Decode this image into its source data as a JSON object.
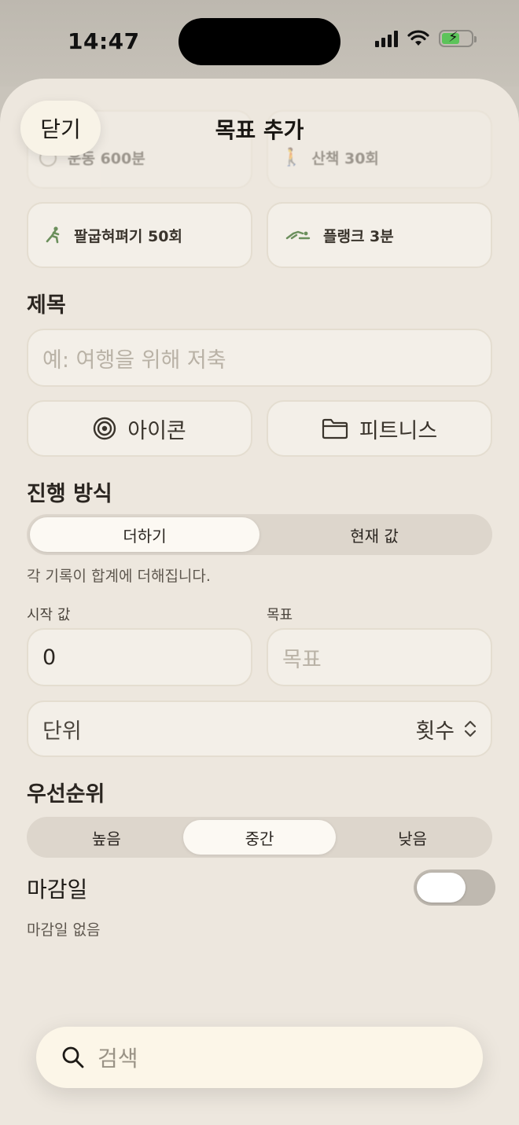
{
  "status_bar": {
    "time": "14:47"
  },
  "sheet": {
    "title": "목표 추가",
    "close_label": "닫기"
  },
  "presets": [
    {
      "label": "운동 600분",
      "icon": "circle-icon"
    },
    {
      "label": "산책 30회",
      "icon": "walk-icon"
    },
    {
      "label": "팔굽혀펴기 50회",
      "icon": "pushup-icon"
    },
    {
      "label": "플랭크 3분",
      "icon": "plank-icon"
    }
  ],
  "title_section": {
    "label": "제목",
    "placeholder": "예: 여행을 위해 저축"
  },
  "icon_button": {
    "label": "아이콘"
  },
  "category_button": {
    "label": "피트니스"
  },
  "progress_mode": {
    "label": "진행 방식",
    "options": [
      "더하기",
      "현재 값"
    ],
    "selected": "더하기",
    "hint": "각 기록이 합계에 더해집니다."
  },
  "values": {
    "start_label": "시작 값",
    "start_value": "0",
    "target_label": "목표",
    "target_placeholder": "목표"
  },
  "unit": {
    "label": "단위",
    "value": "횟수"
  },
  "priority": {
    "label": "우선순위",
    "options": [
      "높음",
      "중간",
      "낮음"
    ],
    "selected": "중간"
  },
  "deadline": {
    "label": "마감일",
    "hint": "마감일 없음",
    "enabled": false
  },
  "search": {
    "placeholder": "검색"
  }
}
